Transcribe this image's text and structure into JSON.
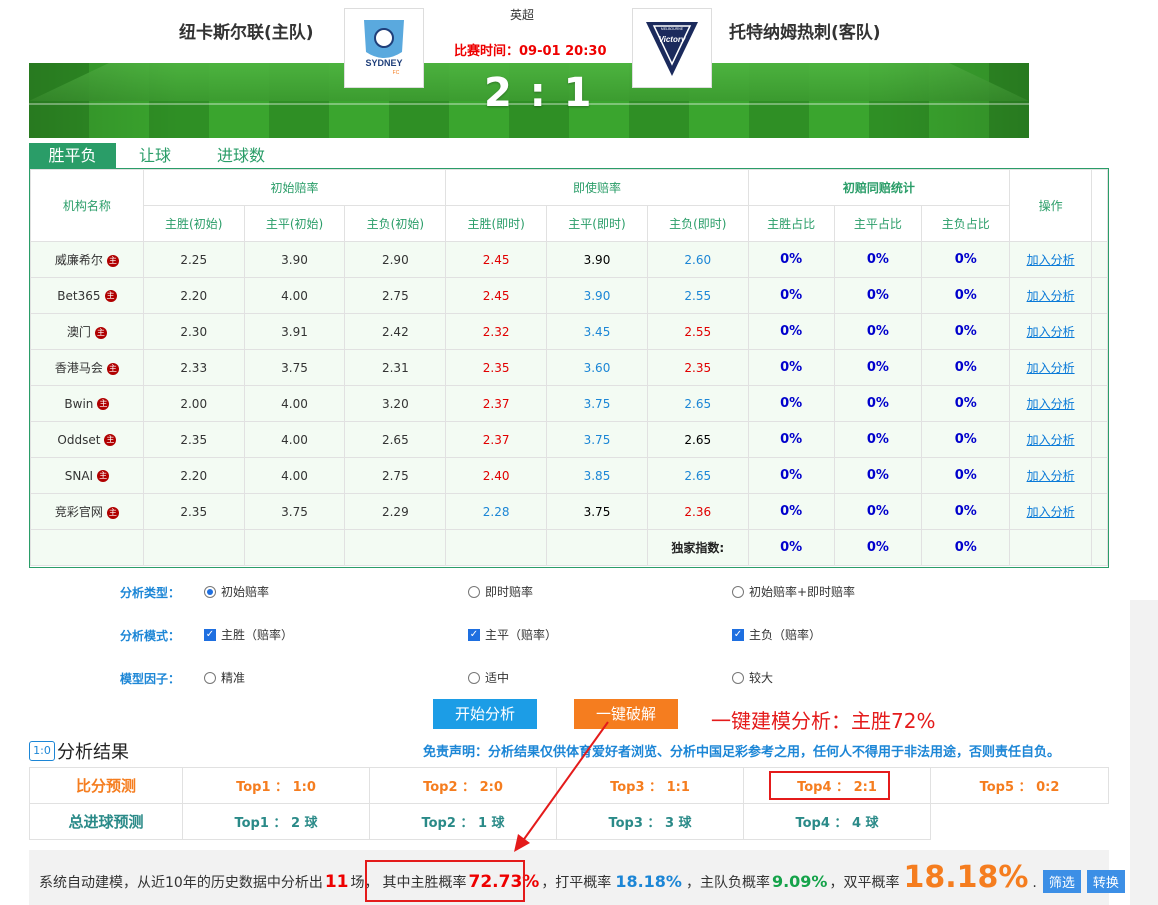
{
  "match": {
    "home_team": "纽卡斯尔联(主队)",
    "away_team": "托特纳姆热刺(客队)",
    "league": "英超",
    "time_label": "比赛时间：09-01 20:30",
    "score": "2 : 1",
    "home_logo_text": "SYDNEY",
    "home_logo_sub": "FC",
    "away_logo_text": "Victory",
    "away_logo_sub": "MELBOURNE"
  },
  "tabs": [
    "胜平负",
    "让球",
    "进球数"
  ],
  "odds_table": {
    "group_headers": [
      "机构名称",
      "初始赔率",
      "即使赔率",
      "初赔同赔统计",
      "操作"
    ],
    "sub_headers": [
      "主胜(初始)",
      "主平(初始)",
      "主负(初始)",
      "主胜(即时)",
      "主平(即时)",
      "主负(即时)",
      "主胜占比",
      "主平占比",
      "主负占比"
    ],
    "rows": [
      {
        "name": "威廉希尔",
        "badge": "主",
        "init": [
          "2.25",
          "3.90",
          "2.90"
        ],
        "live": [
          "2.45",
          "3.90",
          "2.60"
        ],
        "pct": [
          "0%",
          "0%",
          "0%"
        ],
        "action": "加入分析"
      },
      {
        "name": "Bet365",
        "badge": "主",
        "init": [
          "2.20",
          "4.00",
          "2.75"
        ],
        "live": [
          "2.45",
          "3.90",
          "2.55"
        ],
        "pct": [
          "0%",
          "0%",
          "0%"
        ],
        "action": "加入分析"
      },
      {
        "name": "澳门",
        "badge": "主",
        "init": [
          "2.30",
          "3.91",
          "2.42"
        ],
        "live": [
          "2.32",
          "3.45",
          "2.55"
        ],
        "pct": [
          "0%",
          "0%",
          "0%"
        ],
        "action": "加入分析"
      },
      {
        "name": "香港马会",
        "badge": "主",
        "init": [
          "2.33",
          "3.75",
          "2.31"
        ],
        "live": [
          "2.35",
          "3.60",
          "2.35"
        ],
        "pct": [
          "0%",
          "0%",
          "0%"
        ],
        "action": "加入分析"
      },
      {
        "name": "Bwin",
        "badge": "主",
        "init": [
          "2.00",
          "4.00",
          "3.20"
        ],
        "live": [
          "2.37",
          "3.75",
          "2.65"
        ],
        "pct": [
          "0%",
          "0%",
          "0%"
        ],
        "action": "加入分析"
      },
      {
        "name": "Oddset",
        "badge": "主",
        "init": [
          "2.35",
          "4.00",
          "2.65"
        ],
        "live": [
          "2.37",
          "3.75",
          "2.65"
        ],
        "pct": [
          "0%",
          "0%",
          "0%"
        ],
        "action": "加入分析"
      },
      {
        "name": "SNAI",
        "badge": "主",
        "init": [
          "2.20",
          "4.00",
          "2.75"
        ],
        "live": [
          "2.40",
          "3.85",
          "2.65"
        ],
        "pct": [
          "0%",
          "0%",
          "0%"
        ],
        "action": "加入分析"
      },
      {
        "name": "竞彩官网",
        "badge": "主",
        "init": [
          "2.35",
          "3.75",
          "2.29"
        ],
        "live": [
          "2.28",
          "3.75",
          "2.36"
        ],
        "pct": [
          "0%",
          "0%",
          "0%"
        ],
        "action": "加入分析"
      }
    ],
    "live_colors": [
      [
        "red",
        "blk",
        "blue"
      ],
      [
        "red",
        "blue",
        "blue"
      ],
      [
        "red",
        "blue",
        "red"
      ],
      [
        "red",
        "blue",
        "red"
      ],
      [
        "red",
        "blue",
        "blue"
      ],
      [
        "red",
        "blue",
        "blk"
      ],
      [
        "red",
        "blue",
        "blue"
      ],
      [
        "blue",
        "blk",
        "red"
      ]
    ],
    "exclusive_label": "独家指数:",
    "exclusive_pct": [
      "0%",
      "0%",
      "0%"
    ]
  },
  "options": {
    "type_label": "分析类型：",
    "type_options": [
      "初始赔率",
      "即时赔率",
      "初始赔率+即时赔率"
    ],
    "mode_label": "分析模式：",
    "mode_options": [
      "主胜（赔率）",
      "主平（赔率）",
      "主负（赔率）"
    ],
    "factor_label": "模型因子：",
    "factor_options": [
      "精准",
      "适中",
      "较大"
    ]
  },
  "buttons": {
    "start": "开始分析",
    "crack": "一键破解"
  },
  "annotation": "一键建模分析：主胜72%",
  "results": {
    "icon": "1:0",
    "title": "分析结果",
    "disclaimer": "免责声明：分析结果仅供体育爱好者浏览、分析中国足彩参考之用，任何人不得用于非法用途，否则责任自负。",
    "score_label": "比分预测",
    "score_tops": [
      "Top1 ： 1:0",
      "Top2 ： 2:0",
      "Top3 ： 1:1",
      "Top4 ： 2:1",
      "Top5 ： 0:2"
    ],
    "goals_label": "总进球预测",
    "goal_tops": [
      "Top1 ： 2 球",
      "Top2 ： 1 球",
      "Top3 ： 3 球",
      "Top4 ： 4 球"
    ]
  },
  "summary": {
    "p1": "系统自动建模，从近10年的历史数据中分析出",
    "count": "11",
    "p2": "场，",
    "p3": "其中主胜概率",
    "home_win": "72.73%",
    "p4": "，打平概率",
    "draw": "18.18%",
    "p5": "，主队负概率",
    "away_win": "9.09%",
    "p6": "，双平概率",
    "double_draw": "18.18%",
    "p7": ".",
    "filter_btn": "筛选",
    "convert_btn": "转换"
  }
}
